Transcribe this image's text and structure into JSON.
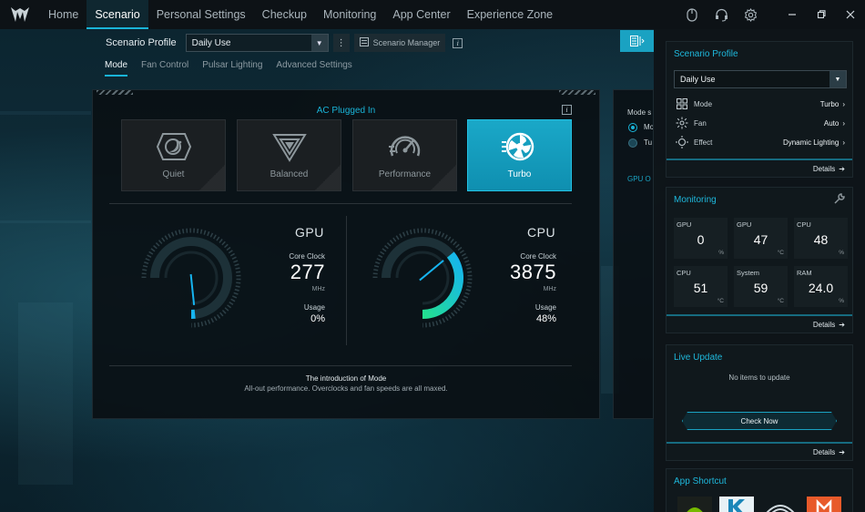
{
  "nav": {
    "items": [
      "Home",
      "Scenario",
      "Personal Settings",
      "Checkup",
      "Monitoring",
      "App Center",
      "Experience Zone"
    ],
    "active": "Scenario"
  },
  "profile_row": {
    "label": "Scenario Profile",
    "selected": "Daily Use",
    "manager_label": "Scenario Manager"
  },
  "subtabs": [
    "Mode",
    "Fan Control",
    "Pulsar Lighting",
    "Advanced Settings"
  ],
  "mode_panel": {
    "power_state": "AC Plugged In",
    "modes": [
      {
        "label": "Quiet",
        "icon": "quiet-icon"
      },
      {
        "label": "Balanced",
        "icon": "balanced-icon"
      },
      {
        "label": "Performance",
        "icon": "performance-icon"
      },
      {
        "label": "Turbo",
        "icon": "turbo-icon"
      }
    ],
    "active_mode": "Turbo",
    "gpu": {
      "title": "GPU",
      "clock_label": "Core Clock",
      "clock": "277",
      "clock_unit": "MHz",
      "usage_label": "Usage",
      "usage": "0%",
      "usage_value": 0
    },
    "cpu": {
      "title": "CPU",
      "clock_label": "Core Clock",
      "clock": "3875",
      "clock_unit": "MHz",
      "usage_label": "Usage",
      "usage": "48%",
      "usage_value": 48
    },
    "intro_title": "The introduction of Mode",
    "intro_desc": "All-out performance. Overclocks and fan speeds are all maxed."
  },
  "mid_panel": {
    "title_fragment": "Mode s",
    "option1": "Mo",
    "option2": "Tu",
    "footer_fragment": "GPU O"
  },
  "sidebar": {
    "scenario": {
      "title": "Scenario Profile",
      "selected": "Daily Use",
      "rows": [
        {
          "label": "Mode",
          "value": "Turbo"
        },
        {
          "label": "Fan",
          "value": "Auto"
        },
        {
          "label": "Effect",
          "value": "Dynamic Lighting"
        }
      ],
      "details": "Details"
    },
    "monitoring": {
      "title": "Monitoring",
      "tiles": [
        {
          "label": "GPU",
          "value": "0",
          "unit": "%"
        },
        {
          "label": "GPU",
          "value": "47",
          "unit": "°C"
        },
        {
          "label": "CPU",
          "value": "48",
          "unit": "%"
        },
        {
          "label": "CPU",
          "value": "51",
          "unit": "°C"
        },
        {
          "label": "System",
          "value": "59",
          "unit": "°C"
        },
        {
          "label": "RAM",
          "value": "24.0",
          "unit": "%"
        }
      ],
      "details": "Details"
    },
    "live_update": {
      "title": "Live Update",
      "empty": "No items to update",
      "button": "Check Now",
      "details": "Details"
    },
    "shortcuts": {
      "title": "App Shortcut"
    }
  },
  "colors": {
    "accent": "#19b4d8",
    "turbo_card": "#1aa8c8",
    "gauge_green": "#23e08e",
    "gauge_blue": "#16b4f0"
  }
}
